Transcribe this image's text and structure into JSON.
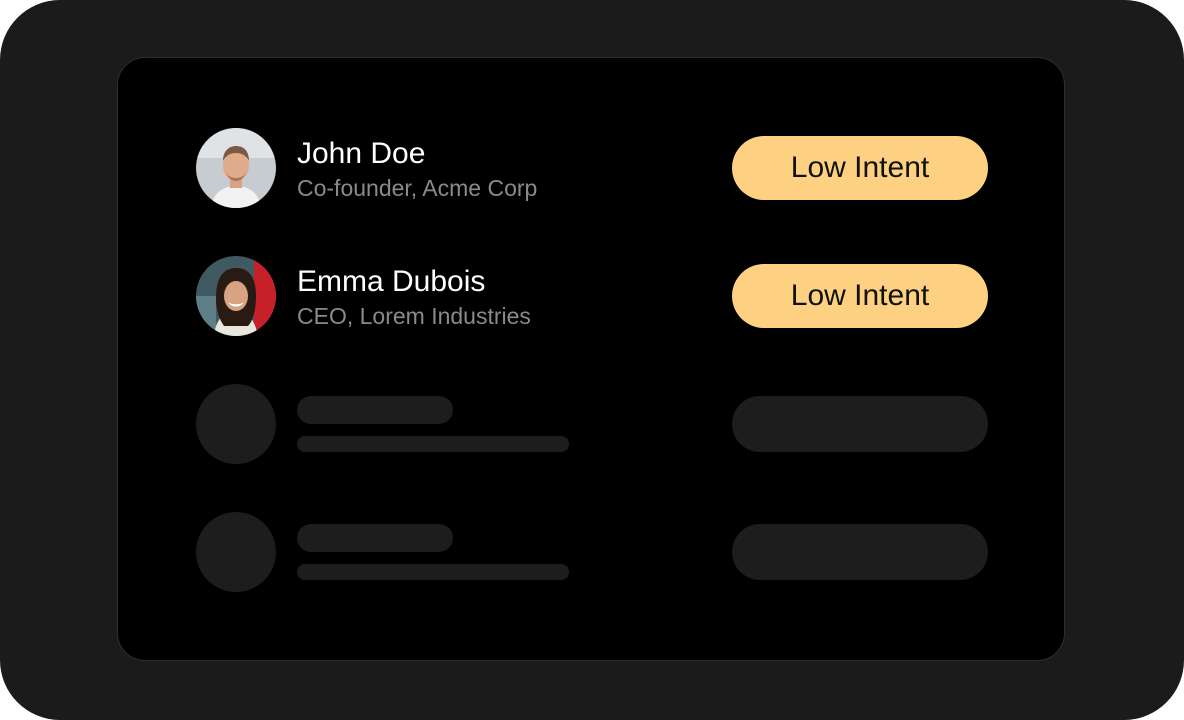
{
  "contacts": [
    {
      "name": "John Doe",
      "role": "Co-founder, Acme Corp",
      "badge": "Low Intent",
      "avatar": "avatar-man-photo"
    },
    {
      "name": "Emma Dubois",
      "role": "CEO, Lorem Industries",
      "badge": "Low Intent",
      "avatar": "avatar-woman-photo"
    }
  ],
  "skeleton_rows": 2,
  "colors": {
    "outer_frame": "#1b1b1b",
    "panel": "#000000",
    "badge": "#fdd181",
    "skeleton": "#1d1d1d",
    "secondary_text": "#8a8a8a"
  }
}
